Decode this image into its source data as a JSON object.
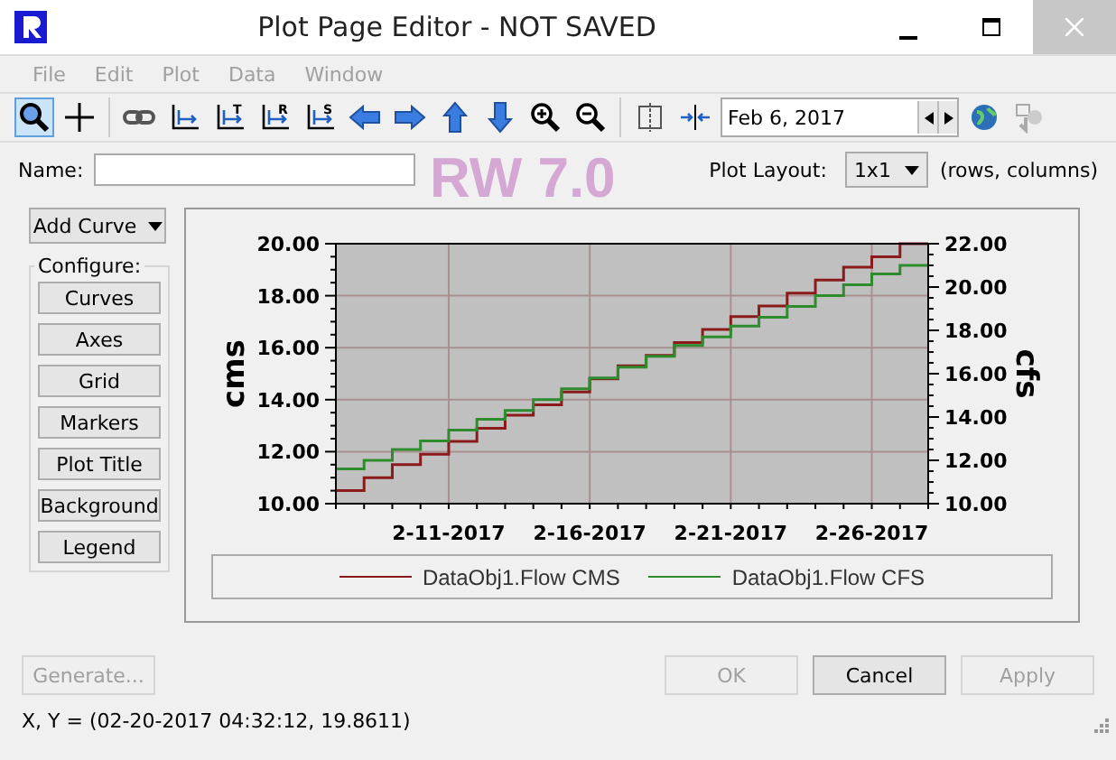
{
  "window": {
    "title": "Plot Page Editor - NOT SAVED"
  },
  "menu": [
    {
      "label": "File",
      "disabled": true
    },
    {
      "label": "Edit",
      "disabled": true
    },
    {
      "label": "Plot",
      "disabled": true
    },
    {
      "label": "Data",
      "disabled": true
    },
    {
      "label": "Window",
      "disabled": true
    }
  ],
  "toolbar": [
    {
      "kind": "zoom",
      "selected": true
    },
    {
      "kind": "crosshair",
      "selected": false
    },
    {
      "kind": "separator"
    },
    {
      "kind": "link",
      "selected": false
    },
    {
      "kind": "axes",
      "selected": false
    },
    {
      "kind": "axes",
      "letter": "T",
      "selected": false
    },
    {
      "kind": "axes",
      "letter": "R",
      "selected": false
    },
    {
      "kind": "axes",
      "letter": "S",
      "selected": false
    },
    {
      "kind": "left",
      "selected": false
    },
    {
      "kind": "right",
      "selected": false
    },
    {
      "kind": "up",
      "selected": false
    },
    {
      "kind": "down",
      "selected": false
    },
    {
      "kind": "zoom-in",
      "selected": false
    },
    {
      "kind": "zoom-out",
      "selected": false
    },
    {
      "kind": "separator"
    },
    {
      "kind": "split",
      "selected": false
    },
    {
      "kind": "collapse",
      "selected": false
    }
  ],
  "date_field": {
    "value": "Feb 6, 2017"
  },
  "watermark": "RW 7.0",
  "name_field": {
    "label": "Name:"
  },
  "plot_layout": {
    "label": "Plot Layout:",
    "value": "1x1",
    "hint": "(rows, columns)"
  },
  "add_curve": "Add Curve",
  "configure": {
    "title": "Configure:",
    "buttons": [
      "Curves",
      "Axes",
      "Grid",
      "Markers",
      "Plot Title",
      "Background",
      "Legend"
    ]
  },
  "chart_data": {
    "type": "line",
    "grid": true,
    "ylabel": "cms",
    "y2label": "cfs",
    "x": [
      "2017-02-07",
      "2017-02-08",
      "2017-02-08",
      "2017-02-09",
      "2017-02-09",
      "2017-02-10",
      "2017-02-10",
      "2017-02-11",
      "2017-02-11",
      "2017-02-12",
      "2017-02-12",
      "2017-02-13",
      "2017-02-13",
      "2017-02-14",
      "2017-02-14",
      "2017-02-15",
      "2017-02-15",
      "2017-02-16",
      "2017-02-16",
      "2017-02-17",
      "2017-02-17",
      "2017-02-18",
      "2017-02-18",
      "2017-02-19",
      "2017-02-19",
      "2017-02-20",
      "2017-02-20",
      "2017-02-21",
      "2017-02-21",
      "2017-02-22",
      "2017-02-22",
      "2017-02-23",
      "2017-02-23",
      "2017-02-24",
      "2017-02-24",
      "2017-02-25",
      "2017-02-25",
      "2017-02-26",
      "2017-02-26",
      "2017-02-27",
      "2017-02-27",
      "2017-02-28"
    ],
    "xlim": [
      "2017-02-07",
      "2017-02-28"
    ],
    "xticks": [
      {
        "value": "2017-02-11",
        "label": "2-11-2017"
      },
      {
        "value": "2017-02-16",
        "label": "2-16-2017"
      },
      {
        "value": "2017-02-21",
        "label": "2-21-2017"
      },
      {
        "value": "2017-02-26",
        "label": "2-26-2017"
      }
    ],
    "ylim": [
      10,
      20
    ],
    "yticks": [
      {
        "value": 10,
        "label": "10.00"
      },
      {
        "value": 12,
        "label": "12.00"
      },
      {
        "value": 14,
        "label": "14.00"
      },
      {
        "value": 16,
        "label": "16.00"
      },
      {
        "value": 18,
        "label": "18.00"
      },
      {
        "value": 20,
        "label": "20.00"
      }
    ],
    "y2lim": [
      10,
      22
    ],
    "y2ticks": [
      {
        "value": 10,
        "label": "10.00"
      },
      {
        "value": 12,
        "label": "12.00"
      },
      {
        "value": 14,
        "label": "14.00"
      },
      {
        "value": 16,
        "label": "16.00"
      },
      {
        "value": 18,
        "label": "18.00"
      },
      {
        "value": 20,
        "label": "20.00"
      },
      {
        "value": 22,
        "label": "22.00"
      }
    ],
    "series": [
      {
        "name": "DataObj1.Flow CMS",
        "color": "#8b1a1a",
        "values": [
          10.5,
          10.5,
          11.0,
          11.0,
          11.5,
          11.5,
          11.9,
          11.9,
          12.4,
          12.4,
          12.9,
          12.9,
          13.4,
          13.4,
          13.8,
          13.8,
          14.3,
          14.3,
          14.8,
          14.8,
          15.3,
          15.3,
          15.7,
          15.7,
          16.2,
          16.2,
          16.7,
          16.7,
          17.2,
          17.2,
          17.6,
          17.6,
          18.1,
          18.1,
          18.6,
          18.6,
          19.1,
          19.1,
          19.5,
          19.5,
          20.0,
          20.0
        ]
      },
      {
        "name": "DataObj1.Flow CFS",
        "color": "#2e8b2e",
        "axis": "y2",
        "values": [
          11.6,
          11.6,
          12.0,
          12.0,
          12.5,
          12.5,
          12.9,
          12.9,
          13.4,
          13.4,
          13.9,
          13.9,
          14.3,
          14.3,
          14.8,
          14.8,
          15.3,
          15.3,
          15.8,
          15.8,
          16.3,
          16.3,
          16.8,
          16.8,
          17.3,
          17.3,
          17.7,
          17.7,
          18.2,
          18.2,
          18.6,
          18.6,
          19.1,
          19.1,
          19.6,
          19.6,
          20.1,
          20.1,
          20.6,
          20.6,
          21.0,
          21.0
        ]
      }
    ]
  },
  "buttons": [
    {
      "label": "Generate...",
      "disabled": true
    },
    {
      "label": "OK",
      "disabled": true
    },
    {
      "label": "Cancel",
      "disabled": false
    },
    {
      "label": "Apply",
      "disabled": true
    }
  ],
  "status": "X, Y = (02-20-2017 04:32:12, 19.8611)"
}
